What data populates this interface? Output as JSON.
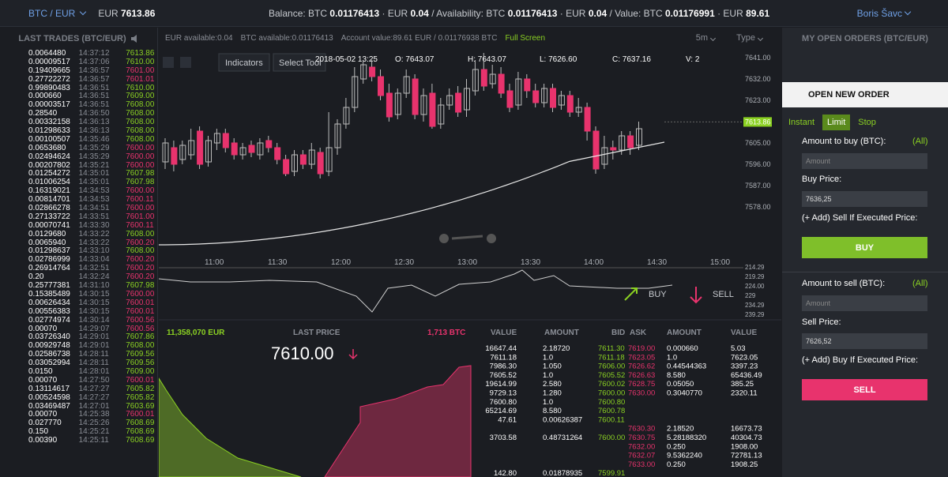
{
  "header": {
    "pair": "BTC / EUR",
    "last_label": "EUR",
    "last_price": "7613.86",
    "bal_label": "Balance: BTC",
    "bal_btc": "0.01176413",
    "bal_eur_label": "· EUR",
    "bal_eur": "0.04",
    "av_label": "/ Availability: BTC",
    "av_btc": "0.01176413",
    "av_eur_label": "· EUR",
    "av_eur": "0.04",
    "val_label": "/ Value: BTC",
    "val_btc": "0.01176991",
    "val_eur_label": "· EUR",
    "val_eur": "89.61",
    "user": "Boris Šavc"
  },
  "trades": {
    "title": "LAST TRADES (BTC/EUR)",
    "rows": [
      [
        "0.0064480",
        "14:37:12",
        "7613.86",
        "u"
      ],
      [
        "0.00009517",
        "14:37:06",
        "7610.00",
        "u"
      ],
      [
        "0.19409665",
        "14:36:57",
        "7601.00",
        "d"
      ],
      [
        "0.27722272",
        "14:36:57",
        "7601.01",
        "d"
      ],
      [
        "0.99890483",
        "14:36:51",
        "7610.00",
        "u"
      ],
      [
        "0.000660",
        "14:36:51",
        "7609.00",
        "u"
      ],
      [
        "0.00003517",
        "14:36:51",
        "7608.00",
        "u"
      ],
      [
        "0.28540",
        "14:36:50",
        "7608.00",
        "u"
      ],
      [
        "0.00332158",
        "14:36:13",
        "7608.00",
        "u"
      ],
      [
        "0.01298633",
        "14:36:13",
        "7608.00",
        "u"
      ],
      [
        "0.00100507",
        "14:35:46",
        "7608.00",
        "u"
      ],
      [
        "0.0653680",
        "14:35:29",
        "7600.00",
        "d"
      ],
      [
        "0.02494624",
        "14:35:29",
        "7600.00",
        "d"
      ],
      [
        "0.00207802",
        "14:35:21",
        "7600.00",
        "d"
      ],
      [
        "0.01254272",
        "14:35:01",
        "7607.98",
        "u"
      ],
      [
        "0.01006254",
        "14:35:01",
        "7607.98",
        "u"
      ],
      [
        "0.16319021",
        "14:34:53",
        "7600.00",
        "d"
      ],
      [
        "0.00814701",
        "14:34:53",
        "7600.11",
        "d"
      ],
      [
        "0.02866278",
        "14:34:51",
        "7600.00",
        "d"
      ],
      [
        "0.27133722",
        "14:33:51",
        "7601.00",
        "d"
      ],
      [
        "0.00070741",
        "14:33:30",
        "7600.11",
        "d"
      ],
      [
        "0.0129680",
        "14:33:22",
        "7608.00",
        "u"
      ],
      [
        "0.0065940",
        "14:33:22",
        "7600.20",
        "d"
      ],
      [
        "0.01298637",
        "14:33:10",
        "7608.00",
        "u"
      ],
      [
        "0.02786999",
        "14:33:04",
        "7600.20",
        "d"
      ],
      [
        "0.26914764",
        "14:32:51",
        "7600.20",
        "d"
      ],
      [
        "0.20",
        "14:32:24",
        "7600.20",
        "d"
      ],
      [
        "0.25777381",
        "14:31:10",
        "7607.98",
        "u"
      ],
      [
        "0.15385489",
        "14:30:15",
        "7600.00",
        "d"
      ],
      [
        "0.00626434",
        "14:30:15",
        "7600.01",
        "d"
      ],
      [
        "0.00556383",
        "14:30:15",
        "7600.01",
        "d"
      ],
      [
        "0.02774974",
        "14:30:14",
        "7600.56",
        "d"
      ],
      [
        "0.00070",
        "14:29:07",
        "7600.56",
        "d"
      ],
      [
        "0.03726340",
        "14:29:01",
        "7607.86",
        "u"
      ],
      [
        "0.00929748",
        "14:29:01",
        "7608.00",
        "u"
      ],
      [
        "0.02586738",
        "14:28:11",
        "7609.56",
        "u"
      ],
      [
        "0.03052994",
        "14:28:11",
        "7609.56",
        "u"
      ],
      [
        "0.0150",
        "14:28:01",
        "7609.00",
        "u"
      ],
      [
        "0.00070",
        "14:27:50",
        "7600.01",
        "d"
      ],
      [
        "0.13114617",
        "14:27:27",
        "7605.82",
        "u"
      ],
      [
        "0.00524598",
        "14:27:27",
        "7605.82",
        "u"
      ],
      [
        "0.03469487",
        "14:27:01",
        "7603.69",
        "u"
      ],
      [
        "0.00070",
        "14:25:38",
        "7600.01",
        "d"
      ],
      [
        "0.027770",
        "14:25:26",
        "7608.69",
        "u"
      ],
      [
        "0.150",
        "14:25:21",
        "7608.69",
        "u"
      ],
      [
        "0.00390",
        "14:25:11",
        "7608.69",
        "u"
      ]
    ]
  },
  "chart": {
    "eur_available": "EUR available:0.04",
    "btc_available": "BTC available:0.01176413",
    "account_value": "Account value:89.61 EUR / 0.01176938 BTC",
    "full_screen": "Full Screen",
    "timeframe": "5m",
    "type": "Type",
    "indicators": "Indicators",
    "select_tool": "Select Tool",
    "date": "2018-05-02 13:25",
    "o": "O: 7643.07",
    "h": "H: 7643.07",
    "l": "L: 7626.60",
    "c": "C: 7637.16",
    "v": "V: 2",
    "price_ticks": [
      "7641.00",
      "7632.00",
      "7623.00",
      "7605.00",
      "7596.00",
      "7587.00",
      "7578.00"
    ],
    "current_price": "7613.86",
    "time_ticks": [
      "11:00",
      "11:30",
      "12:00",
      "12:30",
      "13:00",
      "13:30",
      "14:00",
      "14:30",
      "15:00"
    ],
    "osc_ticks": [
      "214.29",
      "219.29",
      "224.00",
      "229",
      "234.29",
      "239.29"
    ],
    "buy": "BUY",
    "sell": "SELL",
    "colors": {
      "up": "#8bd122",
      "down": "#e8336d"
    }
  },
  "book": {
    "bid_total": "11,358,070 EUR",
    "last_price_label": "LAST PRICE",
    "ask_total": "1,713 BTC",
    "last_price": "7610.00",
    "headers": {
      "value": "VALUE",
      "amount": "AMOUNT",
      "bid": "BID",
      "ask": "ASK",
      "amount2": "AMOUNT",
      "value2": "VALUE"
    },
    "bids": [
      [
        "16647.44",
        "2.18720",
        "7611.30"
      ],
      [
        "7611.18",
        "1.0",
        "7611.18"
      ],
      [
        "7986.30",
        "1.050",
        "7606.00"
      ],
      [
        "7605.52",
        "1.0",
        "7605.52"
      ],
      [
        "19614.99",
        "2.580",
        "7600.02"
      ],
      [
        "9729.13",
        "1.280",
        "7600.00"
      ],
      [
        "7600.80",
        "1.0",
        "7600.80"
      ],
      [
        "65214.69",
        "8.580",
        "7600.78"
      ],
      [
        "47.61",
        "0.00626387",
        "7600.11"
      ],
      [
        "",
        "",
        ""
      ],
      [
        "3703.58",
        "0.48731264",
        "7600.00"
      ],
      [
        "",
        "",
        ""
      ],
      [
        "",
        "",
        ""
      ],
      [
        "",
        "",
        ""
      ],
      [
        "142.80",
        "0.01878935",
        "7599.91"
      ]
    ],
    "asks": [
      [
        "7619.00",
        "0.000660",
        "5.03"
      ],
      [
        "7623.05",
        "1.0",
        "7623.05"
      ],
      [
        "7626.62",
        "0.44544363",
        "3397.23"
      ],
      [
        "7626.63",
        "8.580",
        "65436.49"
      ],
      [
        "7628.75",
        "0.05050",
        "385.25"
      ],
      [
        "7630.00",
        "0.3040770",
        "2320.11"
      ],
      [
        "",
        "",
        ""
      ],
      [
        "",
        "",
        ""
      ],
      [
        "",
        "",
        ""
      ],
      [
        "7630.30",
        "2.18520",
        "16673.73"
      ],
      [
        "7630.75",
        "5.28188320",
        "40304.73"
      ],
      [
        "7632.00",
        "0.250",
        "1908.00"
      ],
      [
        "7632.07",
        "9.5362240",
        "72781.13"
      ],
      [
        "7633.00",
        "0.250",
        "1908.25"
      ]
    ]
  },
  "orders": {
    "title": "MY OPEN ORDERS (BTC/EUR)",
    "new_order": "OPEN NEW ORDER",
    "tabs": [
      "Instant",
      "Limit",
      "Stop"
    ],
    "buy_amount_label": "Amount to buy (BTC):",
    "all": "(All)",
    "amount_placeholder": "Amount",
    "buy_price_label": "Buy Price:",
    "buy_price": "7636,25",
    "sell_if_label": "(+ Add) Sell If Executed Price:",
    "buy_btn": "BUY",
    "sell_amount_label": "Amount to sell (BTC):",
    "sell_price_label": "Sell Price:",
    "sell_price": "7626,52",
    "buy_if_label": "(+ Add) Buy If Executed Price:",
    "sell_btn": "SELL"
  }
}
